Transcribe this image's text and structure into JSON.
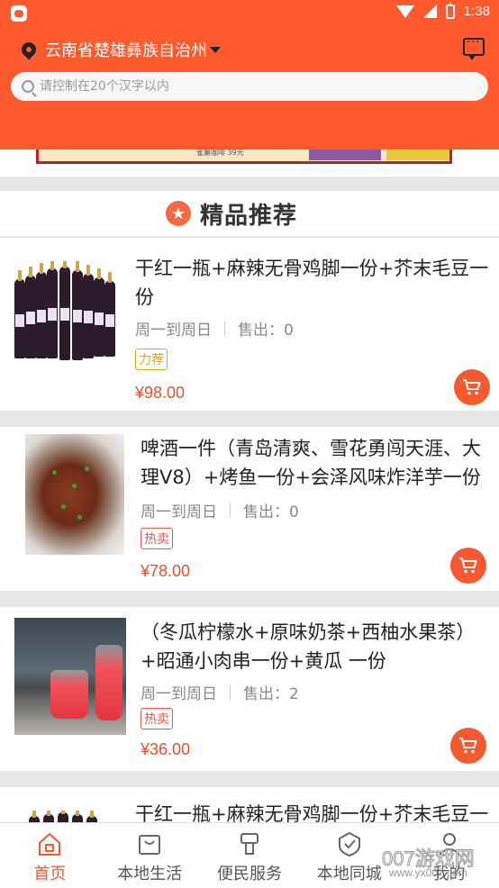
{
  "status_bar": {
    "time": "1:38"
  },
  "header": {
    "location": "云南省楚雄彝族自治州",
    "search_placeholder": "请控制在20个汉字以内"
  },
  "banner": {
    "caption": "雀巢咖啡 39元"
  },
  "section": {
    "star_glyph": "★",
    "title": "精品推荐"
  },
  "products": [
    {
      "title": "干红一瓶+麻辣无骨鸡脚一份+芥末毛豆一份",
      "schedule": "周一到周日",
      "sold": "售出：0",
      "tag": "力荐",
      "price": "¥98.00",
      "image": "wine-bottles"
    },
    {
      "title": "啤酒一件（青岛清爽、雪花勇闯天涯、大理V8）+烤鱼一份+会泽风味炸洋芋一份",
      "schedule": "周一到周日",
      "sold": "售出：0",
      "tag": "热卖",
      "price": "¥78.00",
      "image": "grilled-fish"
    },
    {
      "title": "（冬瓜柠檬水+原味奶茶+西柚水果茶）+昭通小肉串一份+黄瓜 一份",
      "schedule": "周一到周日",
      "sold": "售出：2",
      "tag": "热卖",
      "price": "¥36.00",
      "image": "fruit-drinks"
    },
    {
      "title": "干红一瓶+麻辣无骨鸡脚一份+芥末毛豆一",
      "image": "wine-bottles"
    }
  ],
  "nav": [
    {
      "label": "首页",
      "icon": "home-icon"
    },
    {
      "label": "本地生活",
      "icon": "shopping-bag-icon"
    },
    {
      "label": "便民服务",
      "icon": "service-icon"
    },
    {
      "label": "本地同城",
      "icon": "check-badge-icon"
    },
    {
      "label": "我的",
      "icon": "user-icon"
    }
  ],
  "watermark": {
    "text": "007游戏网",
    "sub": "www.yx007.com"
  },
  "colors": {
    "accent": "#ff5a2e",
    "price": "#e0542f",
    "tag_yellow": "#e0a51a",
    "tag_red": "#e8584a"
  }
}
